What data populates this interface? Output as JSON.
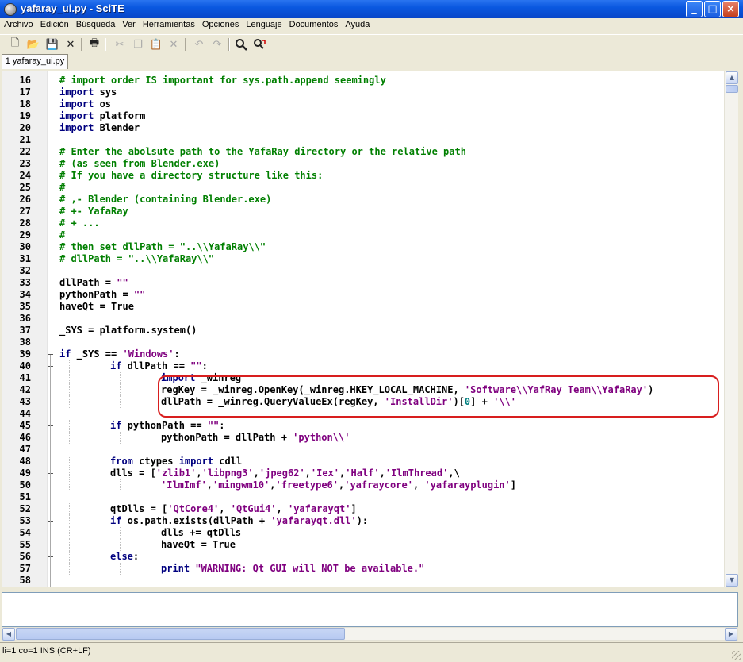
{
  "window": {
    "title": "yafaray_ui.py - SciTE",
    "minimize_label": "_",
    "maximize_label": "□",
    "close_label": "×"
  },
  "menu": [
    "Archivo",
    "Edición",
    "Búsqueda",
    "Ver",
    "Herramientas",
    "Opciones",
    "Lenguaje",
    "Documentos",
    "Ayuda"
  ],
  "toolbar": {
    "buttons": [
      "new-icon",
      "open-icon",
      "save-icon",
      "close-icon",
      "print-icon",
      "cut-icon",
      "copy-icon",
      "paste-icon",
      "delete-icon",
      "undo-icon",
      "redo-icon",
      "find-icon",
      "replace-icon"
    ]
  },
  "tabs": [
    {
      "label": "1 yafaray_ui.py"
    }
  ],
  "editor": {
    "colors": {
      "comment": "#007f00",
      "keyword": "#00007f",
      "string": "#7f007f",
      "number": "#007f7f",
      "highlight_box": "#d81e1e"
    },
    "line_numbers": [
      "16",
      "17",
      "18",
      "19",
      "20",
      "21",
      "22",
      "23",
      "24",
      "25",
      "26",
      "27",
      "28",
      "29",
      "30",
      "31",
      "32",
      "33",
      "34",
      "35",
      "36",
      "37",
      "38",
      "39",
      "40",
      "41",
      "42",
      "43",
      "44",
      "45",
      "46",
      "47",
      "48",
      "49",
      "50",
      "51",
      "52",
      "53",
      "54",
      "55",
      "56",
      "57",
      "58"
    ],
    "lines": [
      [
        [
          "c",
          "# import order IS important for sys.path.append seemingly"
        ]
      ],
      [
        [
          "k",
          "import"
        ],
        [
          "n",
          " sys"
        ]
      ],
      [
        [
          "k",
          "import"
        ],
        [
          "n",
          " os"
        ]
      ],
      [
        [
          "k",
          "import"
        ],
        [
          "n",
          " platform"
        ]
      ],
      [
        [
          "k",
          "import"
        ],
        [
          "n",
          " Blender"
        ]
      ],
      [],
      [
        [
          "c",
          "# Enter the abolsute path to the YafaRay directory or the relative path"
        ]
      ],
      [
        [
          "c",
          "# (as seen from Blender.exe)"
        ]
      ],
      [
        [
          "c",
          "# If you have a directory structure like this:"
        ]
      ],
      [
        [
          "c",
          "#"
        ]
      ],
      [
        [
          "c",
          "# ,- Blender (containing Blender.exe)"
        ]
      ],
      [
        [
          "c",
          "# +- YafaRay"
        ]
      ],
      [
        [
          "c",
          "# + ..."
        ]
      ],
      [
        [
          "c",
          "#"
        ]
      ],
      [
        [
          "c",
          "# then set dllPath = \"..\\\\YafaRay\\\\\""
        ]
      ],
      [
        [
          "c",
          "# dllPath = \"..\\\\YafaRay\\\\\""
        ]
      ],
      [],
      [
        [
          "n",
          "dllPath = "
        ],
        [
          "s",
          "\"\""
        ]
      ],
      [
        [
          "n",
          "pythonPath = "
        ],
        [
          "s",
          "\"\""
        ]
      ],
      [
        [
          "n",
          "haveQt = True"
        ]
      ],
      [],
      [
        [
          "n",
          "_SYS = platform.system()"
        ]
      ],
      [],
      [
        [
          "k",
          "if"
        ],
        [
          "n",
          " _SYS == "
        ],
        [
          "s",
          "'Windows'"
        ],
        [
          "n",
          ":"
        ]
      ],
      [
        [
          "n",
          "\t"
        ],
        [
          "k",
          "if"
        ],
        [
          "n",
          " dllPath == "
        ],
        [
          "s",
          "\"\""
        ],
        [
          "n",
          ":"
        ]
      ],
      [
        [
          "n",
          "\t\t"
        ],
        [
          "k",
          "import"
        ],
        [
          "n",
          " _winreg"
        ]
      ],
      [
        [
          "n",
          "\t\tregKey = _winreg.OpenKey(_winreg.HKEY_LOCAL_MACHINE, "
        ],
        [
          "s",
          "'Software\\\\YafRay Team\\\\YafaRay'"
        ],
        [
          "n",
          ")"
        ]
      ],
      [
        [
          "n",
          "\t\tdllPath = _winreg.QueryValueEx(regKey, "
        ],
        [
          "s",
          "'InstallDir'"
        ],
        [
          "n",
          ")["
        ],
        [
          "m",
          "0"
        ],
        [
          "n",
          "] + "
        ],
        [
          "s",
          "'\\\\'"
        ]
      ],
      [],
      [
        [
          "n",
          "\t"
        ],
        [
          "k",
          "if"
        ],
        [
          "n",
          " pythonPath == "
        ],
        [
          "s",
          "\"\""
        ],
        [
          "n",
          ":"
        ]
      ],
      [
        [
          "n",
          "\t\tpythonPath = dllPath + "
        ],
        [
          "s",
          "'python\\\\'"
        ]
      ],
      [],
      [
        [
          "n",
          "\t"
        ],
        [
          "k",
          "from"
        ],
        [
          "n",
          " ctypes "
        ],
        [
          "k",
          "import"
        ],
        [
          "n",
          " cdll"
        ]
      ],
      [
        [
          "n",
          "\tdlls = ["
        ],
        [
          "s",
          "'zlib1'"
        ],
        [
          "n",
          ","
        ],
        [
          "s",
          "'libpng3'"
        ],
        [
          "n",
          ","
        ],
        [
          "s",
          "'jpeg62'"
        ],
        [
          "n",
          ","
        ],
        [
          "s",
          "'Iex'"
        ],
        [
          "n",
          ","
        ],
        [
          "s",
          "'Half'"
        ],
        [
          "n",
          ","
        ],
        [
          "s",
          "'IlmThread'"
        ],
        [
          "n",
          ",\\"
        ]
      ],
      [
        [
          "n",
          "\t\t"
        ],
        [
          "s",
          "'IlmImf'"
        ],
        [
          "n",
          ","
        ],
        [
          "s",
          "'mingwm10'"
        ],
        [
          "n",
          ","
        ],
        [
          "s",
          "'freetype6'"
        ],
        [
          "n",
          ","
        ],
        [
          "s",
          "'yafraycore'"
        ],
        [
          "n",
          ", "
        ],
        [
          "s",
          "'yafarayplugin'"
        ],
        [
          "n",
          "]"
        ]
      ],
      [],
      [
        [
          "n",
          "\tqtDlls = ["
        ],
        [
          "s",
          "'QtCore4'"
        ],
        [
          "n",
          ", "
        ],
        [
          "s",
          "'QtGui4'"
        ],
        [
          "n",
          ", "
        ],
        [
          "s",
          "'yafarayqt'"
        ],
        [
          "n",
          "]"
        ]
      ],
      [
        [
          "n",
          "\t"
        ],
        [
          "k",
          "if"
        ],
        [
          "n",
          " os.path.exists(dllPath + "
        ],
        [
          "s",
          "'yafarayqt.dll'"
        ],
        [
          "n",
          "):"
        ]
      ],
      [
        [
          "n",
          "\t\tdlls += qtDlls"
        ]
      ],
      [
        [
          "n",
          "\t\thaveQt = True"
        ]
      ],
      [
        [
          "n",
          "\t"
        ],
        [
          "k",
          "else"
        ],
        [
          "n",
          ":"
        ]
      ],
      [
        [
          "n",
          "\t\t"
        ],
        [
          "k",
          "print"
        ],
        [
          "n",
          " "
        ],
        [
          "s",
          "\"WARNING: Qt GUI will NOT be available.\""
        ]
      ],
      []
    ],
    "folds": [
      23,
      24,
      29,
      33,
      37,
      40
    ]
  },
  "status": {
    "text": "li=1 co=1 INS (CR+LF)"
  }
}
